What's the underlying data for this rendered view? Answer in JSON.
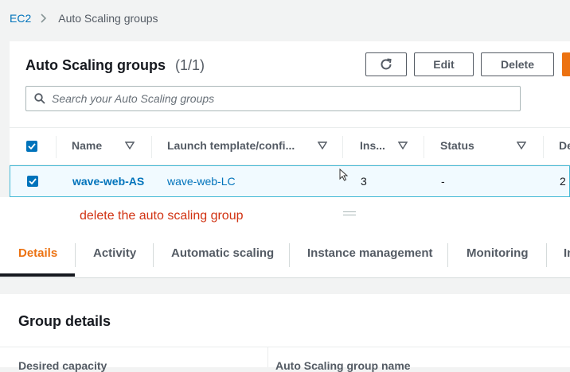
{
  "breadcrumb": {
    "root": "EC2",
    "current": "Auto Scaling groups"
  },
  "panel": {
    "title": "Auto Scaling groups",
    "count": "(1/1)",
    "edit_label": "Edit",
    "delete_label": "Delete"
  },
  "search": {
    "placeholder": "Search your Auto Scaling groups"
  },
  "table": {
    "headers": [
      "Name",
      "Launch template/confi...",
      "Ins...",
      "Status",
      "De"
    ],
    "rows": [
      {
        "name": "wave-web-AS",
        "launch": "wave-web-LC",
        "instances": "3",
        "status": "-",
        "desired": "2",
        "selected": true
      }
    ]
  },
  "annotation": "delete the auto scaling group",
  "tabs": [
    "Details",
    "Activity",
    "Automatic scaling",
    "Instance management",
    "Monitoring",
    "In"
  ],
  "active_tab": "Details",
  "details": {
    "title": "Group details",
    "labels": [
      "Desired capacity",
      "Auto Scaling group name"
    ]
  },
  "colors": {
    "link": "#0073bb",
    "accent": "#ec7211",
    "annotation": "#d13212",
    "selected_row": "#f1faff"
  }
}
